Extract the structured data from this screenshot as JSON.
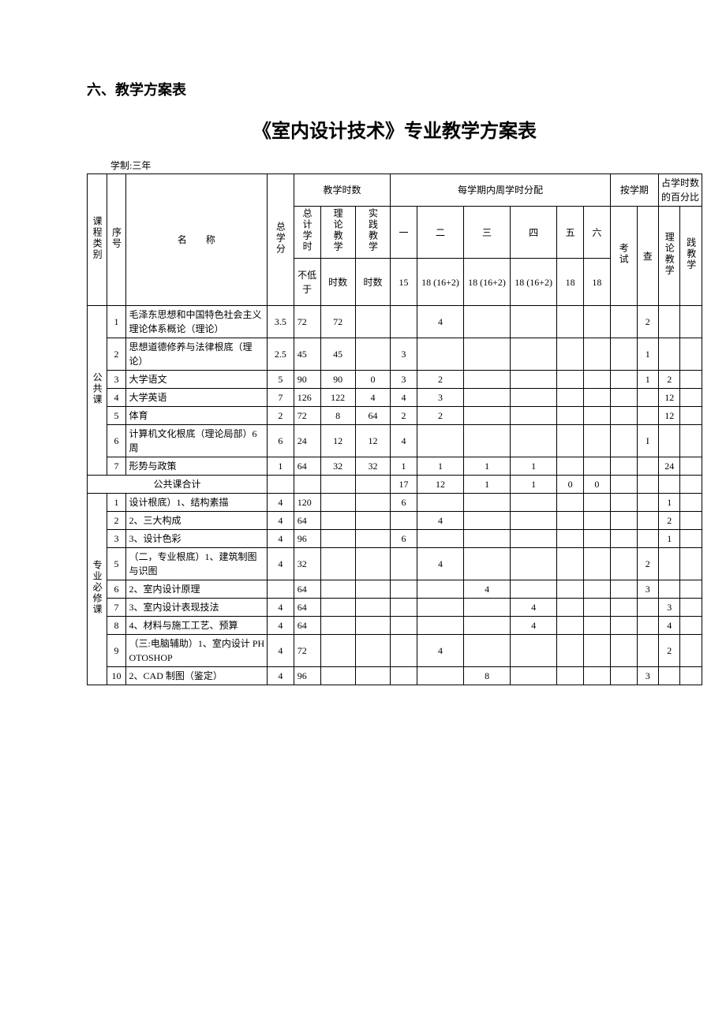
{
  "headings": {
    "section": "六、教学方案表",
    "title": "《室内设计技术》专业教学方案表",
    "meta": "学制:三年"
  },
  "headers": {
    "course_category": "课程类别",
    "seq": "序号",
    "name": "名　　称",
    "total_credits": "总学分",
    "teach_hours": "教学时数",
    "total_hours": "总计学时",
    "not_less_than": "不低于",
    "theory_teach": "理论教学",
    "hours": "时数",
    "practice_teach": "实践教学",
    "per_semester": "每学期内周学时分配",
    "by_semester": "按学期",
    "pct_hours": "占学时数的百分比",
    "sem1": "一",
    "sem2": "二",
    "sem3": "三",
    "sem4": "四",
    "sem5": "五",
    "sem6": "六",
    "exam": "考试",
    "check": "查",
    "theory_teach2": "理论教学",
    "practice_teach2": "践教学",
    "w15": "15",
    "w18a": "18 (16+2)",
    "w18b": "18 (16+2)",
    "w18c": "18 (16+2)",
    "w18d": "18",
    "w18e": "18"
  },
  "chart_data": {
    "type": "table",
    "title": "《室内设计技术》专业教学方案表",
    "columns": [
      "课程类别",
      "序号",
      "名称",
      "总学分",
      "总计学时(不低于)",
      "理论教学时数",
      "实践教学时数",
      "一",
      "二",
      "三",
      "四",
      "五",
      "六",
      "考试",
      "查",
      "理论教学",
      "实践教学"
    ],
    "rows": [
      [
        "公共课",
        "1",
        "毛泽东思想和中国特色社会主义理论体系概论（理论）",
        "3.5",
        "72",
        "72",
        "",
        "",
        "4",
        "",
        "",
        "",
        "",
        "",
        "2",
        "",
        ""
      ],
      [
        "公共课",
        "2",
        "思想道德修养与法律根底（理论）",
        "2.5",
        "45",
        "45",
        "",
        "3",
        "",
        "",
        "",
        "",
        "",
        "",
        "1",
        "",
        ""
      ],
      [
        "公共课",
        "3",
        "大学语文",
        "5",
        "90",
        "90",
        "0",
        "3",
        "2",
        "",
        "",
        "",
        "",
        "",
        "1",
        "2",
        ""
      ],
      [
        "公共课",
        "4",
        "大学英语",
        "7",
        "126",
        "122",
        "4",
        "4",
        "3",
        "",
        "",
        "",
        "",
        "",
        "",
        "12",
        ""
      ],
      [
        "公共课",
        "5",
        "体育",
        "2",
        "72",
        "8",
        "64",
        "2",
        "2",
        "",
        "",
        "",
        "",
        "",
        "",
        "12",
        ""
      ],
      [
        "公共课",
        "6",
        "计算机文化根底（理论局部）6 周",
        "6",
        "24",
        "12",
        "12",
        "4",
        "",
        "",
        "",
        "",
        "",
        "",
        "I",
        "",
        ""
      ],
      [
        "公共课",
        "7",
        "形势与政策",
        "1",
        "64",
        "32",
        "32",
        "1",
        "1",
        "1",
        "1",
        "",
        "",
        "",
        "",
        "24",
        ""
      ],
      [
        "",
        "",
        "公共课合计",
        "",
        "",
        "",
        "",
        "17",
        "12",
        "1",
        "1",
        "0",
        "0",
        "",
        "",
        "",
        ""
      ],
      [
        "专业必修课",
        "1",
        "设计根底）1、结构素描",
        "4",
        "120",
        "",
        "",
        "6",
        "",
        "",
        "",
        "",
        "",
        "",
        "",
        "1",
        ""
      ],
      [
        "专业必修课",
        "2",
        "2、三大构成",
        "4",
        "64",
        "",
        "",
        "",
        "4",
        "",
        "",
        "",
        "",
        "",
        "",
        "2",
        ""
      ],
      [
        "专业必修课",
        "3",
        "3、设计色彩",
        "4",
        "96",
        "",
        "",
        "6",
        "",
        "",
        "",
        "",
        "",
        "",
        "",
        "1",
        ""
      ],
      [
        "专业必修课",
        "5",
        "（二，专业根底）1、建筑制图与识图",
        "4",
        "32",
        "",
        "",
        "",
        "4",
        "",
        "",
        "",
        "",
        "",
        "2",
        "",
        ""
      ],
      [
        "专业必修课",
        "6",
        "2、室内设计原理",
        "",
        "64",
        "",
        "",
        "",
        "",
        "4",
        "",
        "",
        "",
        "",
        "3",
        "",
        ""
      ],
      [
        "专业必修课",
        "7",
        "3、室内设计表现技法",
        "4",
        "64",
        "",
        "",
        "",
        "",
        "",
        "4",
        "",
        "",
        "",
        "",
        "3",
        ""
      ],
      [
        "专业必修课",
        "8",
        "4、材料与施工工艺、预算",
        "4",
        "64",
        "",
        "",
        "",
        "",
        "",
        "4",
        "",
        "",
        "",
        "",
        "4",
        ""
      ],
      [
        "专业必修课",
        "9",
        "（三:电脑辅助）1、室内设计 PHOTOSHOP",
        "4",
        "72",
        "",
        "",
        "",
        "4",
        "",
        "",
        "",
        "",
        "",
        "",
        "2",
        ""
      ],
      [
        "专业必修课",
        "10",
        "2、CAD 制图（鉴定）",
        "4",
        "96",
        "",
        "",
        "",
        "",
        "8",
        "",
        "",
        "",
        "",
        "3",
        "",
        ""
      ]
    ]
  },
  "categories": {
    "public": "公共课",
    "required": "专业必修课"
  },
  "rows": {
    "r1": {
      "seq": "1",
      "name": "毛泽东思想和中国特色社会主义理论体系概论（理论）",
      "credits": "3.5",
      "total": "72",
      "theory": "72",
      "practice": "",
      "s1": "",
      "s2": "4",
      "s3": "",
      "s4": "",
      "s5": "",
      "s6": "",
      "exam": "",
      "check": "2",
      "pt": "",
      "pp": ""
    },
    "r2": {
      "seq": "2",
      "name": "思想道德修养与法律根底（理论）",
      "credits": "2.5",
      "total": "45",
      "theory": "45",
      "practice": "",
      "s1": "3",
      "s2": "",
      "s3": "",
      "s4": "",
      "s5": "",
      "s6": "",
      "exam": "",
      "check": "1",
      "pt": "",
      "pp": ""
    },
    "r3": {
      "seq": "3",
      "name": "大学语文",
      "credits": "5",
      "total": "90",
      "theory": "90",
      "practice": "0",
      "s1": "3",
      "s2": "2",
      "s3": "",
      "s4": "",
      "s5": "",
      "s6": "",
      "exam": "",
      "check": "1",
      "pt": "2",
      "pp": ""
    },
    "r4": {
      "seq": "4",
      "name": "大学英语",
      "credits": "7",
      "total": "126",
      "theory": "122",
      "practice": "4",
      "s1": "4",
      "s2": "3",
      "s3": "",
      "s4": "",
      "s5": "",
      "s6": "",
      "exam": "",
      "check": "",
      "pt": "12",
      "pp": ""
    },
    "r5": {
      "seq": "5",
      "name": "体育",
      "credits": "2",
      "total": "72",
      "theory": "8",
      "practice": "64",
      "s1": "2",
      "s2": "2",
      "s3": "",
      "s4": "",
      "s5": "",
      "s6": "",
      "exam": "",
      "check": "",
      "pt": "12",
      "pp": ""
    },
    "r6": {
      "seq": "6",
      "name": "计算机文化根底（理论局部）6 周",
      "credits": "6",
      "total": "24",
      "theory": "12",
      "practice": "12",
      "s1": "4",
      "s2": "",
      "s3": "",
      "s4": "",
      "s5": "",
      "s6": "",
      "exam": "",
      "check": "I",
      "pt": "",
      "pp": ""
    },
    "r7": {
      "seq": "7",
      "name": "形势与政策",
      "credits": "1",
      "total": "64",
      "theory": "32",
      "practice": "32",
      "s1": "1",
      "s2": "1",
      "s3": "1",
      "s4": "1",
      "s5": "",
      "s6": "",
      "exam": "",
      "check": "",
      "pt": "24",
      "pp": ""
    },
    "subtotal": {
      "name": "公共课合计",
      "credits": "",
      "total": "",
      "theory": "",
      "practice": "",
      "s1": "17",
      "s2": "12",
      "s3": "1",
      "s4": "1",
      "s5": "0",
      "s6": "0",
      "exam": "",
      "check": "",
      "pt": "",
      "pp": ""
    },
    "p1": {
      "seq": "1",
      "name": "设计根底）1、结构素描",
      "credits": "4",
      "total": "120",
      "theory": "",
      "practice": "",
      "s1": "6",
      "s2": "",
      "s3": "",
      "s4": "",
      "s5": "",
      "s6": "",
      "exam": "",
      "check": "",
      "pt": "1",
      "pp": ""
    },
    "p2": {
      "seq": "2",
      "name": "2、三大构成",
      "credits": "4",
      "total": "64",
      "theory": "",
      "practice": "",
      "s1": "",
      "s2": "4",
      "s3": "",
      "s4": "",
      "s5": "",
      "s6": "",
      "exam": "",
      "check": "",
      "pt": "2",
      "pp": ""
    },
    "p3": {
      "seq": "3",
      "name": "3、设计色彩",
      "credits": "4",
      "total": "96",
      "theory": "",
      "practice": "",
      "s1": "6",
      "s2": "",
      "s3": "",
      "s4": "",
      "s5": "",
      "s6": "",
      "exam": "",
      "check": "",
      "pt": "1",
      "pp": ""
    },
    "p5": {
      "seq": "5",
      "name": "（二，专业根底）1、建筑制图与识图",
      "credits": "4",
      "total": "32",
      "theory": "",
      "practice": "",
      "s1": "",
      "s2": "4",
      "s3": "",
      "s4": "",
      "s5": "",
      "s6": "",
      "exam": "",
      "check": "2",
      "pt": "",
      "pp": ""
    },
    "p6": {
      "seq": "6",
      "name": "2、室内设计原理",
      "credits": "",
      "total": "64",
      "theory": "",
      "practice": "",
      "s1": "",
      "s2": "",
      "s3": "4",
      "s4": "",
      "s5": "",
      "s6": "",
      "exam": "",
      "check": "3",
      "pt": "",
      "pp": ""
    },
    "p7": {
      "seq": "7",
      "name": "3、室内设计表现技法",
      "credits": "4",
      "total": "64",
      "theory": "",
      "practice": "",
      "s1": "",
      "s2": "",
      "s3": "",
      "s4": "4",
      "s5": "",
      "s6": "",
      "exam": "",
      "check": "",
      "pt": "3",
      "pp": ""
    },
    "p8": {
      "seq": "8",
      "name": "4、材料与施工工艺、预算",
      "credits": "4",
      "total": "64",
      "theory": "",
      "practice": "",
      "s1": "",
      "s2": "",
      "s3": "",
      "s4": "4",
      "s5": "",
      "s6": "",
      "exam": "",
      "check": "",
      "pt": "4",
      "pp": ""
    },
    "p9": {
      "seq": "9",
      "name": "（三:电脑辅助）1、室内设计 PHOTOSHOP",
      "credits": "4",
      "total": "72",
      "theory": "",
      "practice": "",
      "s1": "",
      "s2": "4",
      "s3": "",
      "s4": "",
      "s5": "",
      "s6": "",
      "exam": "",
      "check": "",
      "pt": "2",
      "pp": ""
    },
    "p10": {
      "seq": "10",
      "name": "2、CAD 制图（鉴定）",
      "credits": "4",
      "total": "96",
      "theory": "",
      "practice": "",
      "s1": "",
      "s2": "",
      "s3": "8",
      "s4": "",
      "s5": "",
      "s6": "",
      "exam": "",
      "check": "3",
      "pt": "",
      "pp": ""
    }
  }
}
